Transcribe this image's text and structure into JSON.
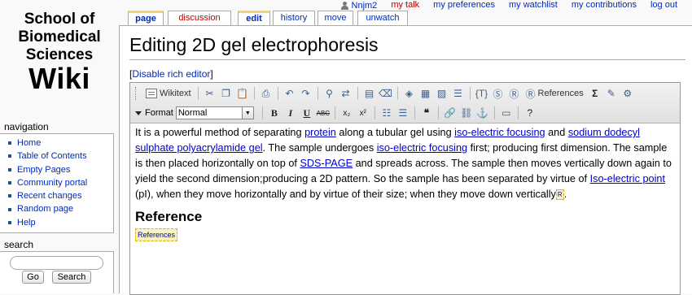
{
  "logo": {
    "line1": "School of",
    "line2": "Biomedical",
    "line3": "Sciences",
    "line4": "Wiki"
  },
  "personal_tools": {
    "user": "Nnjm2",
    "my_talk": "my talk",
    "my_preferences": "my preferences",
    "my_watchlist": "my watchlist",
    "my_contributions": "my contributions",
    "log_out": "log out"
  },
  "tabs": {
    "page": "page",
    "discussion": "discussion",
    "edit": "edit",
    "history": "history",
    "move": "move",
    "unwatch": "unwatch"
  },
  "page": {
    "title": "Editing 2D gel electrophoresis",
    "disable_open": "[",
    "disable_link": "Disable rich editor",
    "disable_close": "]"
  },
  "toolbar": {
    "wikitext": "Wikitext",
    "references": "References",
    "format_label": "Format",
    "format_value": "Normal",
    "sigma": "Σ"
  },
  "article": {
    "p1": "It is a powerful method of separating ",
    "l_protein": "protein",
    "p2": " along a tubular gel using ",
    "l_ief1": "iso-electric focusing",
    "p3": " and ",
    "l_sds": "sodium dodecyl sulphate polyacrylamide gel",
    "p4": ". The sample undergoes ",
    "l_ief2": "iso-electric focusing",
    "p5": " first; producing first dimension. The sample is then placed horizontally on top of ",
    "l_sdspage": "SDS-PAGE",
    "p6": " and spreads across. The sample then moves vertically down again to yield the second dimension;producing a 2D pattern. So the sample has been separated by virtue of ",
    "l_iep": "Iso-electric point",
    "p7": " (pI), when they move horizontally and by virtue of their size; when they move down vertically",
    "ref_marker": "R",
    "p8": ".",
    "heading": "Reference",
    "references_marker": "References"
  },
  "navigation": {
    "title": "navigation",
    "items": [
      "Home",
      "Table of Contents",
      "Empty Pages",
      "Community portal",
      "Recent changes",
      "Random page",
      "Help"
    ]
  },
  "search": {
    "title": "search",
    "value": "",
    "go": "Go",
    "search": "Search"
  }
}
